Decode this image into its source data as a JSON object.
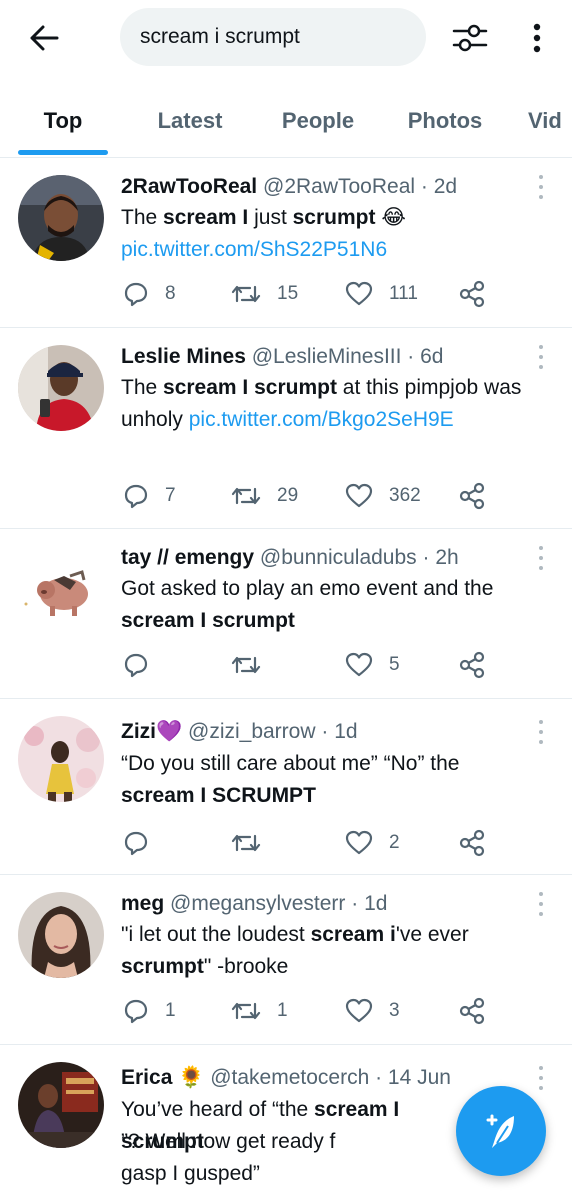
{
  "search": {
    "query": "scream i scrumpt"
  },
  "tabs": [
    {
      "label": "Top"
    },
    {
      "label": "Latest"
    },
    {
      "label": "People"
    },
    {
      "label": "Photos"
    },
    {
      "label": "Vid"
    }
  ],
  "tweets": [
    {
      "name": "2RawTooReal",
      "handle": "@2RawTooReal",
      "time": "· 2d",
      "text": [
        "The ",
        "scream I",
        " just ",
        "scrumpt",
        " 😂"
      ],
      "link": "pic.twitter.com/ShS22P51N6",
      "replies": "8",
      "retweets": "15",
      "likes": "111"
    },
    {
      "name": "Leslie Mines",
      "handle": "@LeslieMinesIII",
      "time": "· 6d",
      "text": [
        "The ",
        "scream I scrumpt",
        " at this pimpjob was unholy "
      ],
      "link": "pic.twitter.com/Bkgo2SeH9E",
      "replies": "7",
      "retweets": "29",
      "likes": "362"
    },
    {
      "name": "tay // emengy",
      "handle": "@bunniculadubs",
      "time": "· 2h",
      "text": [
        "Got asked to play an emo event and the ",
        "scream I scrumpt"
      ],
      "replies": "",
      "retweets": "",
      "likes": "5"
    },
    {
      "name": "Zizi💜",
      "handle": "@zizi_barrow",
      "time": "· 1d",
      "text": [
        "“Do you still care about me” “No” the ",
        "scream I SCRUMPT"
      ],
      "replies": "",
      "retweets": "",
      "likes": "2"
    },
    {
      "name": "meg",
      "handle": "@megansylvesterr",
      "time": "· 1d",
      "text": [
        "\"i let out the loudest ",
        "scream i",
        "'ve ever ",
        "scrumpt",
        "\" -brooke"
      ],
      "replies": "1",
      "retweets": "1",
      "likes": "3"
    },
    {
      "name": "Erica 🌻",
      "handle": "@takemetocerch",
      "time": "· 14 Jun",
      "text": [
        "You’ve heard of “the ",
        "scream I scrumpt",
        "”? Well now get ready f",
        "",
        "gasp I gusped”"
      ]
    }
  ],
  "icons": {
    "back": "arrow-left-icon",
    "filter": "sliders-icon",
    "more": "vertical-dots-icon",
    "reply": "reply-icon",
    "retweet": "retweet-icon",
    "like": "heart-icon",
    "share": "share-icon",
    "compose": "compose-icon"
  },
  "colors": {
    "accent": "#1d9bf0",
    "text": "#0f1419",
    "muted": "#536471"
  }
}
